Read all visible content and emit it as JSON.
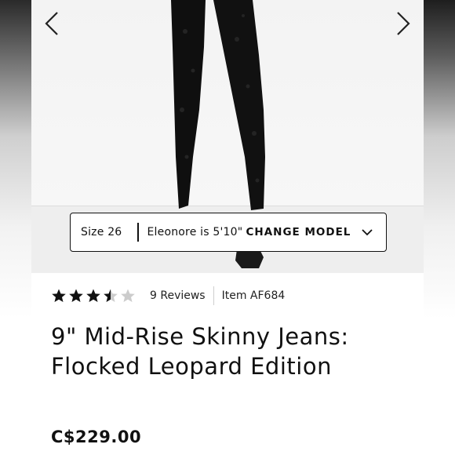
{
  "colors": {
    "text": "#111111",
    "star_filled": "#111111",
    "star_empty": "#cccccc",
    "divider": "#cfcfcf"
  },
  "gallery": {
    "prev_icon": "chevron-left-icon",
    "next_icon": "chevron-right-icon"
  },
  "fit_selector": {
    "size_label": "Size 26",
    "model_height": "Eleonore is 5'10\"",
    "change_model_label": "CHANGE MODEL",
    "chevron_icon": "chevron-down-icon"
  },
  "rating": {
    "value": 3.5,
    "max": 5,
    "reviews_label": "9 Reviews",
    "item_code": "Item AF684"
  },
  "product": {
    "title_line1": "9\" Mid-Rise Skinny Jeans:",
    "title_line2": "Flocked Leopard Edition",
    "price": "C$229.00"
  }
}
